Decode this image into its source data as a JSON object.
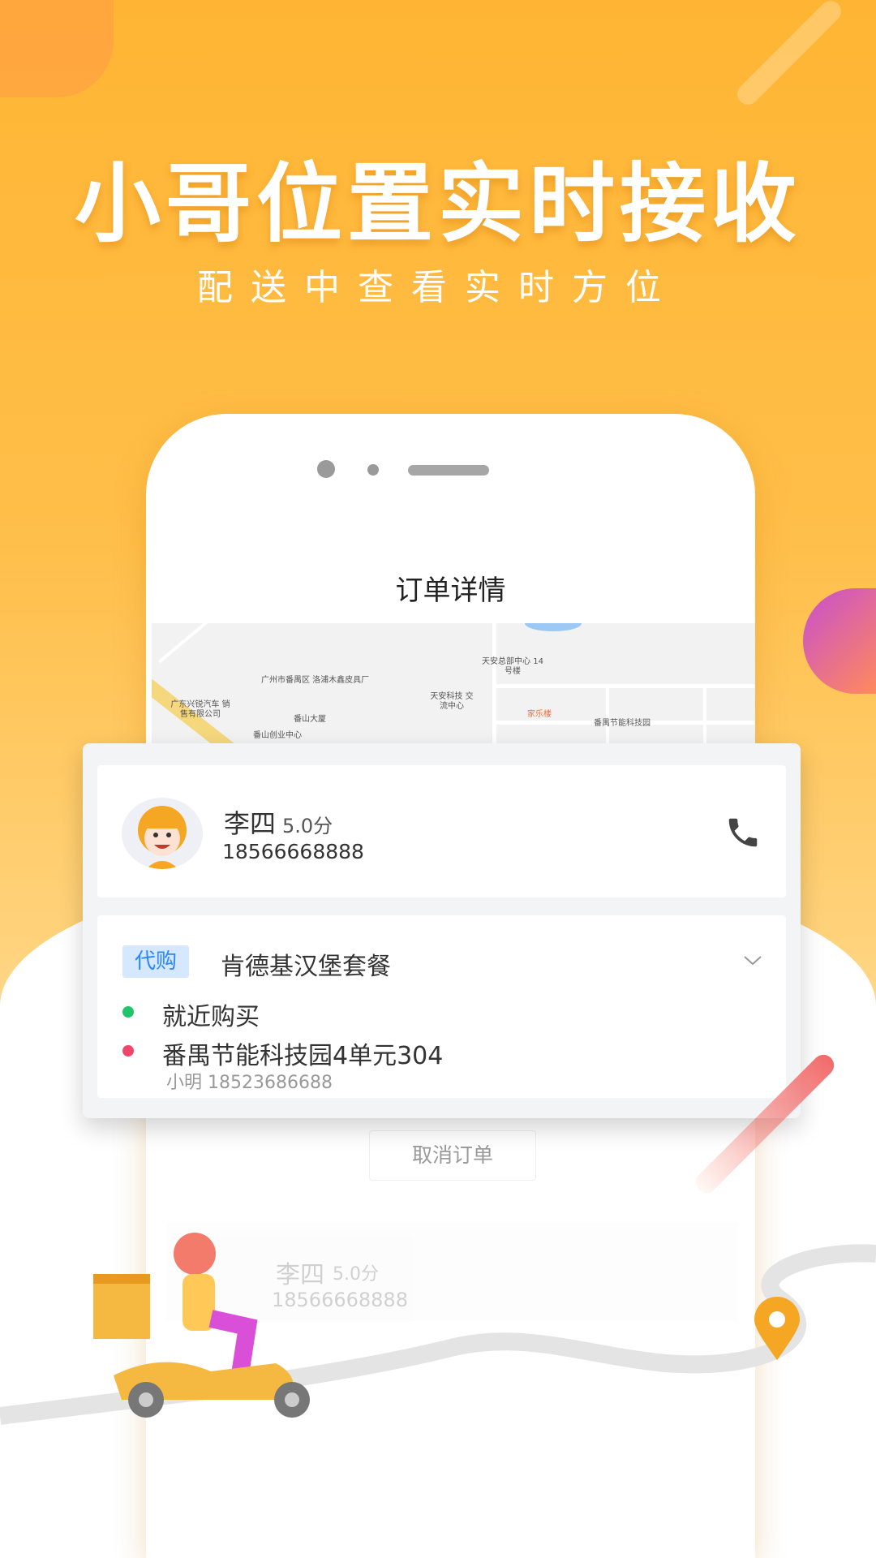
{
  "promo": {
    "title": "小哥位置实时接收",
    "subtitle": "配送中查看实时方位"
  },
  "app": {
    "title": "订单详情"
  },
  "map": {
    "labels": [
      "广州市番禺区 洛浦木鑫皮具厂",
      "广东兴锐汽车 销售有限公司",
      "番山大厦",
      "番山创业中心",
      "天安科技 交流中心",
      "天安总部中心 14号楼",
      "家乐楼",
      "番禺节能科技园"
    ]
  },
  "courier": {
    "name": "李四",
    "rating": "5.0分",
    "phone": "18566668888",
    "call_icon": "phone-icon"
  },
  "order": {
    "tag": "代购",
    "item": "肯德基汉堡套餐",
    "pickup": "就近购买",
    "address": "番禺节能科技园4单元304",
    "receiver": "小明 18523686688",
    "colors": {
      "pickup": "#1fc66b",
      "address": "#f1466c",
      "tag": "#2a86ff"
    }
  },
  "cancel_label": "取消订单",
  "background_card": {
    "name": "李四",
    "rating": "5.0分",
    "phone": "18566668888"
  }
}
